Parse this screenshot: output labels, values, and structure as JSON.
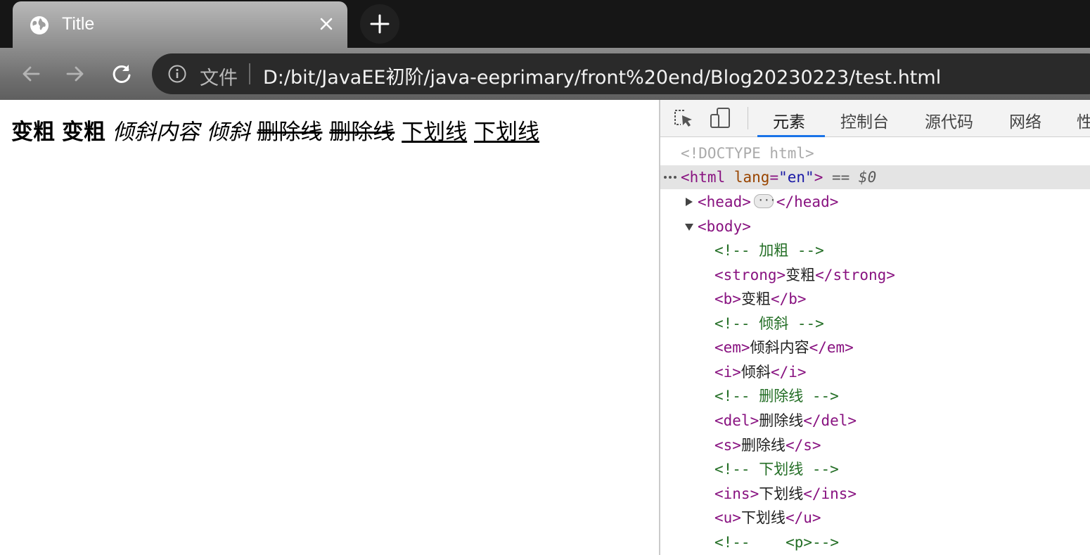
{
  "browser": {
    "tab_title": "Title",
    "scheme_label": "文件",
    "url": "D:/bit/JavaEE初阶/java-eeprimary/front%20end/Blog20230223/test.html"
  },
  "page": {
    "strong_text": "变粗",
    "b_text": "变粗",
    "em_text": "倾斜内容",
    "i_text": "倾斜",
    "del_text": "删除线",
    "s_text": "删除线",
    "ins_text": "下划线",
    "u_text": "下划线"
  },
  "devtools": {
    "tabs": [
      "元素",
      "控制台",
      "源代码",
      "网络",
      "性"
    ],
    "active_tab": "元素",
    "dom": {
      "doctype": "<!DOCTYPE html>",
      "html_open": "<html",
      "lang_attr": "lang",
      "lang_value": "\"en\"",
      "html_close_bracket": ">",
      "selected_marker": "== $0",
      "head_open": "<head>",
      "head_close": "</head>",
      "body_open": "<body>",
      "comment_bold": "<!-- 加粗 -->",
      "strong_open": "<strong>",
      "strong_text": "变粗",
      "strong_close": "</strong>",
      "b_open": "<b>",
      "b_text": "变粗",
      "b_close": "</b>",
      "comment_italic": "<!-- 倾斜 -->",
      "em_open": "<em>",
      "em_text": "倾斜内容",
      "em_close": "</em>",
      "i_open": "<i>",
      "i_text": "倾斜",
      "i_close": "</i>",
      "comment_del": "<!-- 删除线 -->",
      "del_open": "<del>",
      "del_text": "删除线",
      "del_close": "</del>",
      "s_open": "<s>",
      "s_text": "删除线",
      "s_close": "</s>",
      "comment_underline": "<!-- 下划线 -->",
      "ins_open": "<ins>",
      "ins_text": "下划线",
      "ins_close": "</ins>",
      "u_open": "<u>",
      "u_text": "下划线",
      "u_close": "</u>",
      "comment_p": "<!--    <p>-->"
    }
  },
  "icons": {
    "tab_favicon": "globe-icon",
    "tab_close": "close-icon",
    "new_tab": "plus-icon",
    "back": "arrow-left-icon",
    "forward": "arrow-right-icon",
    "reload": "reload-icon",
    "site_info": "info-icon",
    "inspect": "inspect-cursor-icon",
    "device": "device-toolbar-icon"
  },
  "colors": {
    "devtools_tag": "#881280",
    "devtools_attr": "#994500",
    "devtools_value": "#1a1aa6",
    "devtools_comment": "#236e25",
    "active_tab_underline": "#1a73e8"
  }
}
